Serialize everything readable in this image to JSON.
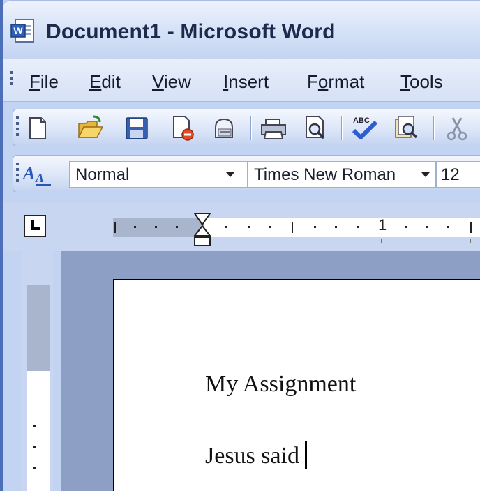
{
  "window": {
    "title": "Document1 - Microsoft Word",
    "app_icon": "word-document-icon"
  },
  "menu": {
    "items": [
      {
        "label_pre": "",
        "label_ul": "F",
        "label_post": "ile"
      },
      {
        "label_pre": "",
        "label_ul": "E",
        "label_post": "dit"
      },
      {
        "label_pre": "",
        "label_ul": "V",
        "label_post": "iew"
      },
      {
        "label_pre": "",
        "label_ul": "I",
        "label_post": "nsert"
      },
      {
        "label_pre": "F",
        "label_ul": "o",
        "label_post": "rmat"
      },
      {
        "label_pre": "",
        "label_ul": "T",
        "label_post": "ools"
      }
    ]
  },
  "standard_toolbar": {
    "buttons": [
      "new-blank-document-icon",
      "open-folder-icon",
      "save-icon",
      "permission-icon",
      "email-icon",
      "print-icon",
      "print-preview-icon",
      "spelling-grammar-icon",
      "research-icon",
      "cut-icon"
    ]
  },
  "formatting_toolbar": {
    "styles_icon": "styles-and-formatting-icon",
    "style_value": "Normal",
    "font_value": "Times New Roman",
    "size_value": "12"
  },
  "ruler": {
    "label": "1"
  },
  "document": {
    "lines": [
      "My Assignment",
      "Jesus said"
    ]
  },
  "colors": {
    "title_bar": "#d9e4f8",
    "workspace": "#8e9fc5",
    "page": "#ffffff"
  }
}
